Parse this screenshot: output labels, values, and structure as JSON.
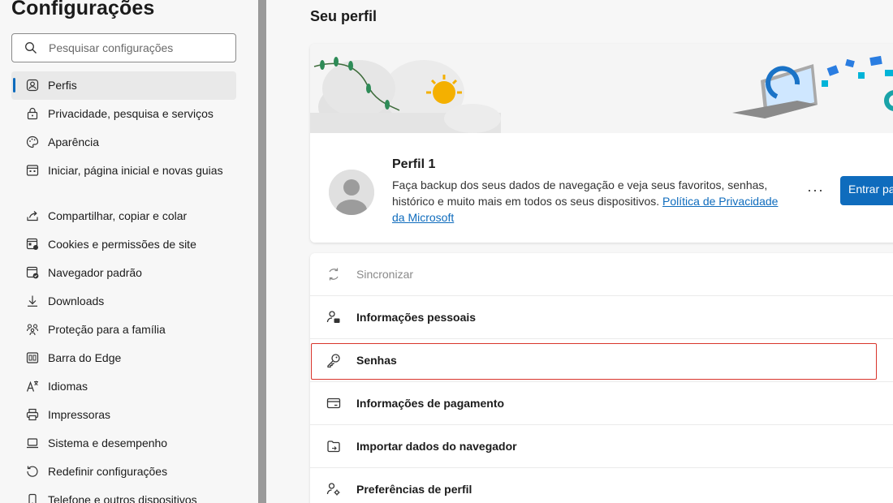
{
  "sidebar": {
    "title": "Configurações",
    "search": {
      "placeholder": "Pesquisar configurações"
    },
    "items": [
      {
        "label": "Perfis",
        "icon": "profile-icon",
        "active": true
      },
      {
        "label": "Privacidade, pesquisa e serviços",
        "icon": "lock-icon"
      },
      {
        "label": "Aparência",
        "icon": "palette-icon"
      },
      {
        "label": "Iniciar, página inicial e novas guias",
        "icon": "home-window-icon"
      },
      {
        "label": "Compartilhar, copiar e colar",
        "icon": "share-icon"
      },
      {
        "label": "Cookies e permissões de site",
        "icon": "cookie-icon"
      },
      {
        "label": "Navegador padrão",
        "icon": "default-browser-icon"
      },
      {
        "label": "Downloads",
        "icon": "download-icon"
      },
      {
        "label": "Proteção para a família",
        "icon": "family-icon"
      },
      {
        "label": "Barra do Edge",
        "icon": "edge-bar-icon"
      },
      {
        "label": "Idiomas",
        "icon": "language-icon"
      },
      {
        "label": "Impressoras",
        "icon": "printer-icon"
      },
      {
        "label": "Sistema e desempenho",
        "icon": "laptop-icon"
      },
      {
        "label": "Redefinir configurações",
        "icon": "reset-icon"
      },
      {
        "label": "Telefone e outros dispositivos",
        "icon": "phone-icon"
      }
    ]
  },
  "main": {
    "title": "Seu perfil",
    "profile": {
      "name": "Perfil 1",
      "description": "Faça backup dos seus dados de navegação e veja seus favoritos, senhas, histórico e muito mais em todos os seus dispositivos.",
      "privacy_link": "Política de Privacidade da Microsoft",
      "more_label": "···",
      "signin_label": "Entrar para sincronizar dados"
    },
    "rows": [
      {
        "label": "Sincronizar",
        "icon": "sync-icon",
        "disabled": true
      },
      {
        "label": "Informações pessoais",
        "icon": "personal-info-icon"
      },
      {
        "label": "Senhas",
        "icon": "key-icon"
      },
      {
        "label": "Informações de pagamento",
        "icon": "credit-card-icon"
      },
      {
        "label": "Importar dados do navegador",
        "icon": "import-icon"
      },
      {
        "label": "Preferências de perfil",
        "icon": "profile-settings-icon"
      }
    ]
  },
  "colors": {
    "accent": "#0f6cbd",
    "highlight": "#d9342b"
  }
}
